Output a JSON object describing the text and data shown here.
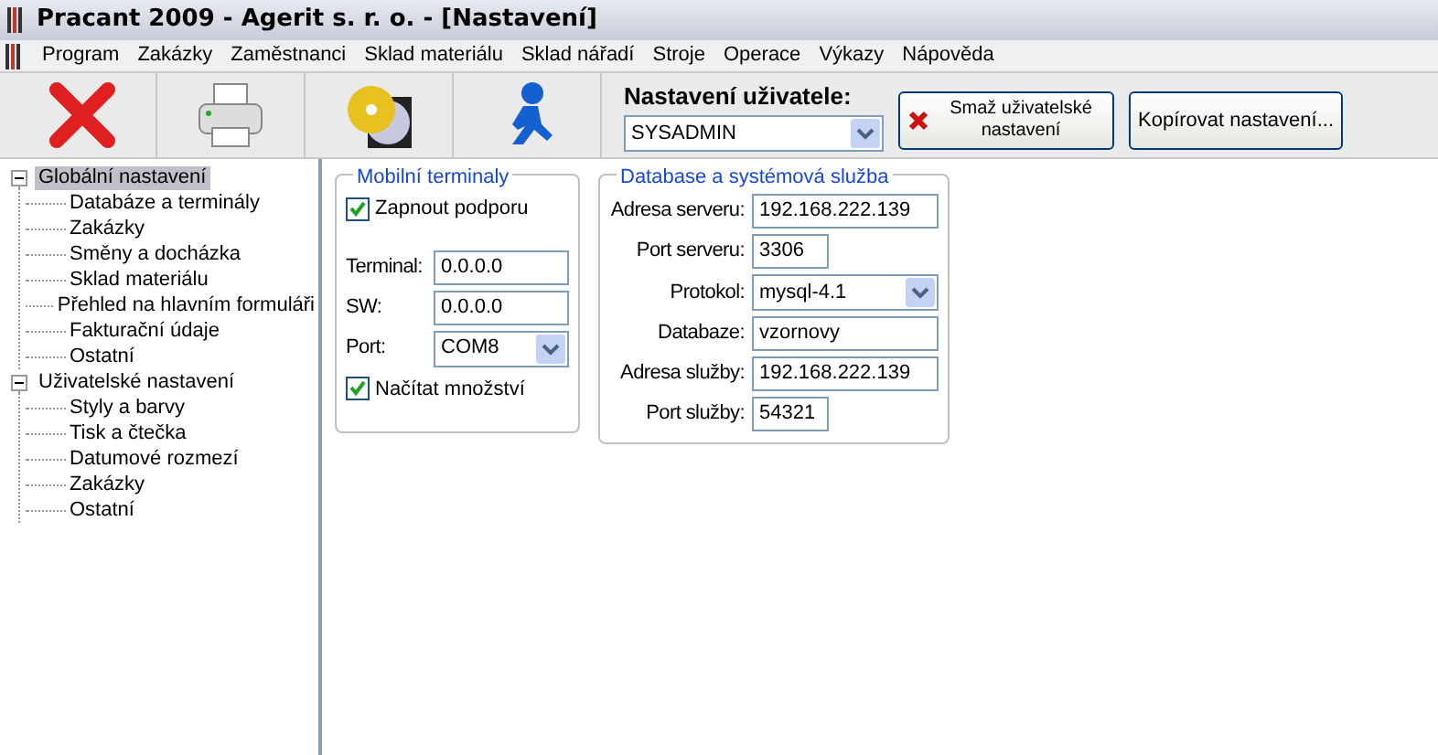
{
  "window": {
    "title": "Pracant 2009 - Agerit s. r. o. - [Nastavení]"
  },
  "menu": [
    "Program",
    "Zakázky",
    "Zaměstnanci",
    "Sklad materiálu",
    "Sklad nářadí",
    "Stroje",
    "Operace",
    "Výkazy",
    "Nápověda"
  ],
  "toolbar": {
    "tools": [
      {
        "kind": "close"
      },
      {
        "kind": "print"
      },
      {
        "kind": "discs"
      },
      {
        "kind": "runner"
      }
    ],
    "user_settings": {
      "label": "Nastavení uživatele:",
      "value": "SYSADMIN"
    },
    "buttons": [
      {
        "label": "Smaž uživatelské nastavení",
        "kind": "delete"
      },
      {
        "label": "Kopírovat nastavení...",
        "kind": "plain"
      }
    ]
  },
  "tree": [
    {
      "label": "Globální nastavení",
      "selected": true,
      "expanded": true,
      "children": [
        {
          "label": "Databáze a terminály",
          "selected": false
        },
        {
          "label": "Zakázky",
          "selected": false
        },
        {
          "label": "Směny a docházka",
          "selected": false
        },
        {
          "label": "Sklad materiálu",
          "selected": false
        },
        {
          "label": "Přehled na hlavním formuláři",
          "selected": false
        },
        {
          "label": "Fakturační údaje",
          "selected": false
        },
        {
          "label": "Ostatní",
          "selected": false
        }
      ]
    },
    {
      "label": "Uživatelské nastavení",
      "selected": false,
      "expanded": true,
      "children": [
        {
          "label": "Styly a barvy",
          "selected": false
        },
        {
          "label": "Tisk a čtečka",
          "selected": false
        },
        {
          "label": "Datumové rozmezí",
          "selected": false
        },
        {
          "label": "Zakázky",
          "selected": false
        },
        {
          "label": "Ostatní",
          "selected": false
        }
      ]
    }
  ],
  "mobile": {
    "title": "Mobilní terminaly",
    "support": {
      "label": "Zapnout podporu",
      "checked": true
    },
    "fields": [
      {
        "label": "Terminal:",
        "value": "0.0.0.0",
        "kind": "text"
      },
      {
        "label": "SW:",
        "value": "0.0.0.0",
        "kind": "text"
      },
      {
        "label": "Port:",
        "value": "COM8",
        "kind": "select"
      }
    ],
    "quantity": {
      "label": "Načítat množství",
      "checked": true
    }
  },
  "database": {
    "title": "Database a systémová služba",
    "fields": [
      {
        "label": "Adresa serveru:",
        "value": "192.168.222.139",
        "kind": "text"
      },
      {
        "label": "Port serveru:",
        "value": "3306",
        "kind": "short"
      },
      {
        "label": "Protokol:",
        "value": "mysql-4.1",
        "kind": "select"
      },
      {
        "label": "Databaze:",
        "value": "vzornovy",
        "kind": "text"
      },
      {
        "label": "Adresa služby:",
        "value": "192.168.222.139",
        "kind": "text"
      },
      {
        "label": "Port služby:",
        "value": "54321",
        "kind": "short"
      }
    ]
  }
}
